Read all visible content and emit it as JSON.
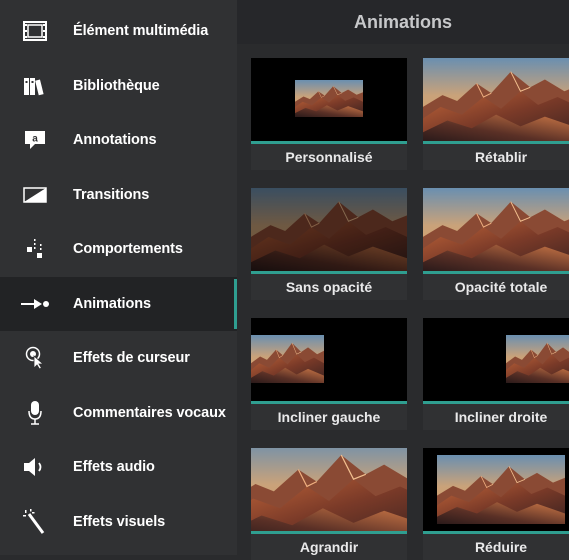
{
  "sidebar": {
    "items": [
      {
        "label": "Élément multimédia",
        "icon": "film-icon"
      },
      {
        "label": "Bibliothèque",
        "icon": "library-icon"
      },
      {
        "label": "Annotations",
        "icon": "annotation-icon"
      },
      {
        "label": "Transitions",
        "icon": "transition-icon"
      },
      {
        "label": "Comportements",
        "icon": "behaviors-icon"
      },
      {
        "label": "Animations",
        "icon": "animation-arrow-icon",
        "active": true
      },
      {
        "label": "Effets de curseur",
        "icon": "cursor-effects-icon"
      },
      {
        "label": "Commentaires vocaux",
        "icon": "microphone-icon"
      },
      {
        "label": "Effets audio",
        "icon": "speaker-icon"
      },
      {
        "label": "Effets visuels",
        "icon": "magic-wand-icon"
      }
    ]
  },
  "main": {
    "title": "Animations",
    "tiles": [
      {
        "label": "Personnalisé"
      },
      {
        "label": "Rétablir"
      },
      {
        "label": "Sans opacité"
      },
      {
        "label": "Opacité totale"
      },
      {
        "label": "Incliner gauche"
      },
      {
        "label": "Incliner droite"
      },
      {
        "label": "Agrandir"
      },
      {
        "label": "Réduire"
      }
    ]
  },
  "colors": {
    "accent": "#2f9e90",
    "sidebar_bg": "#303133",
    "active_bg": "#222325"
  }
}
